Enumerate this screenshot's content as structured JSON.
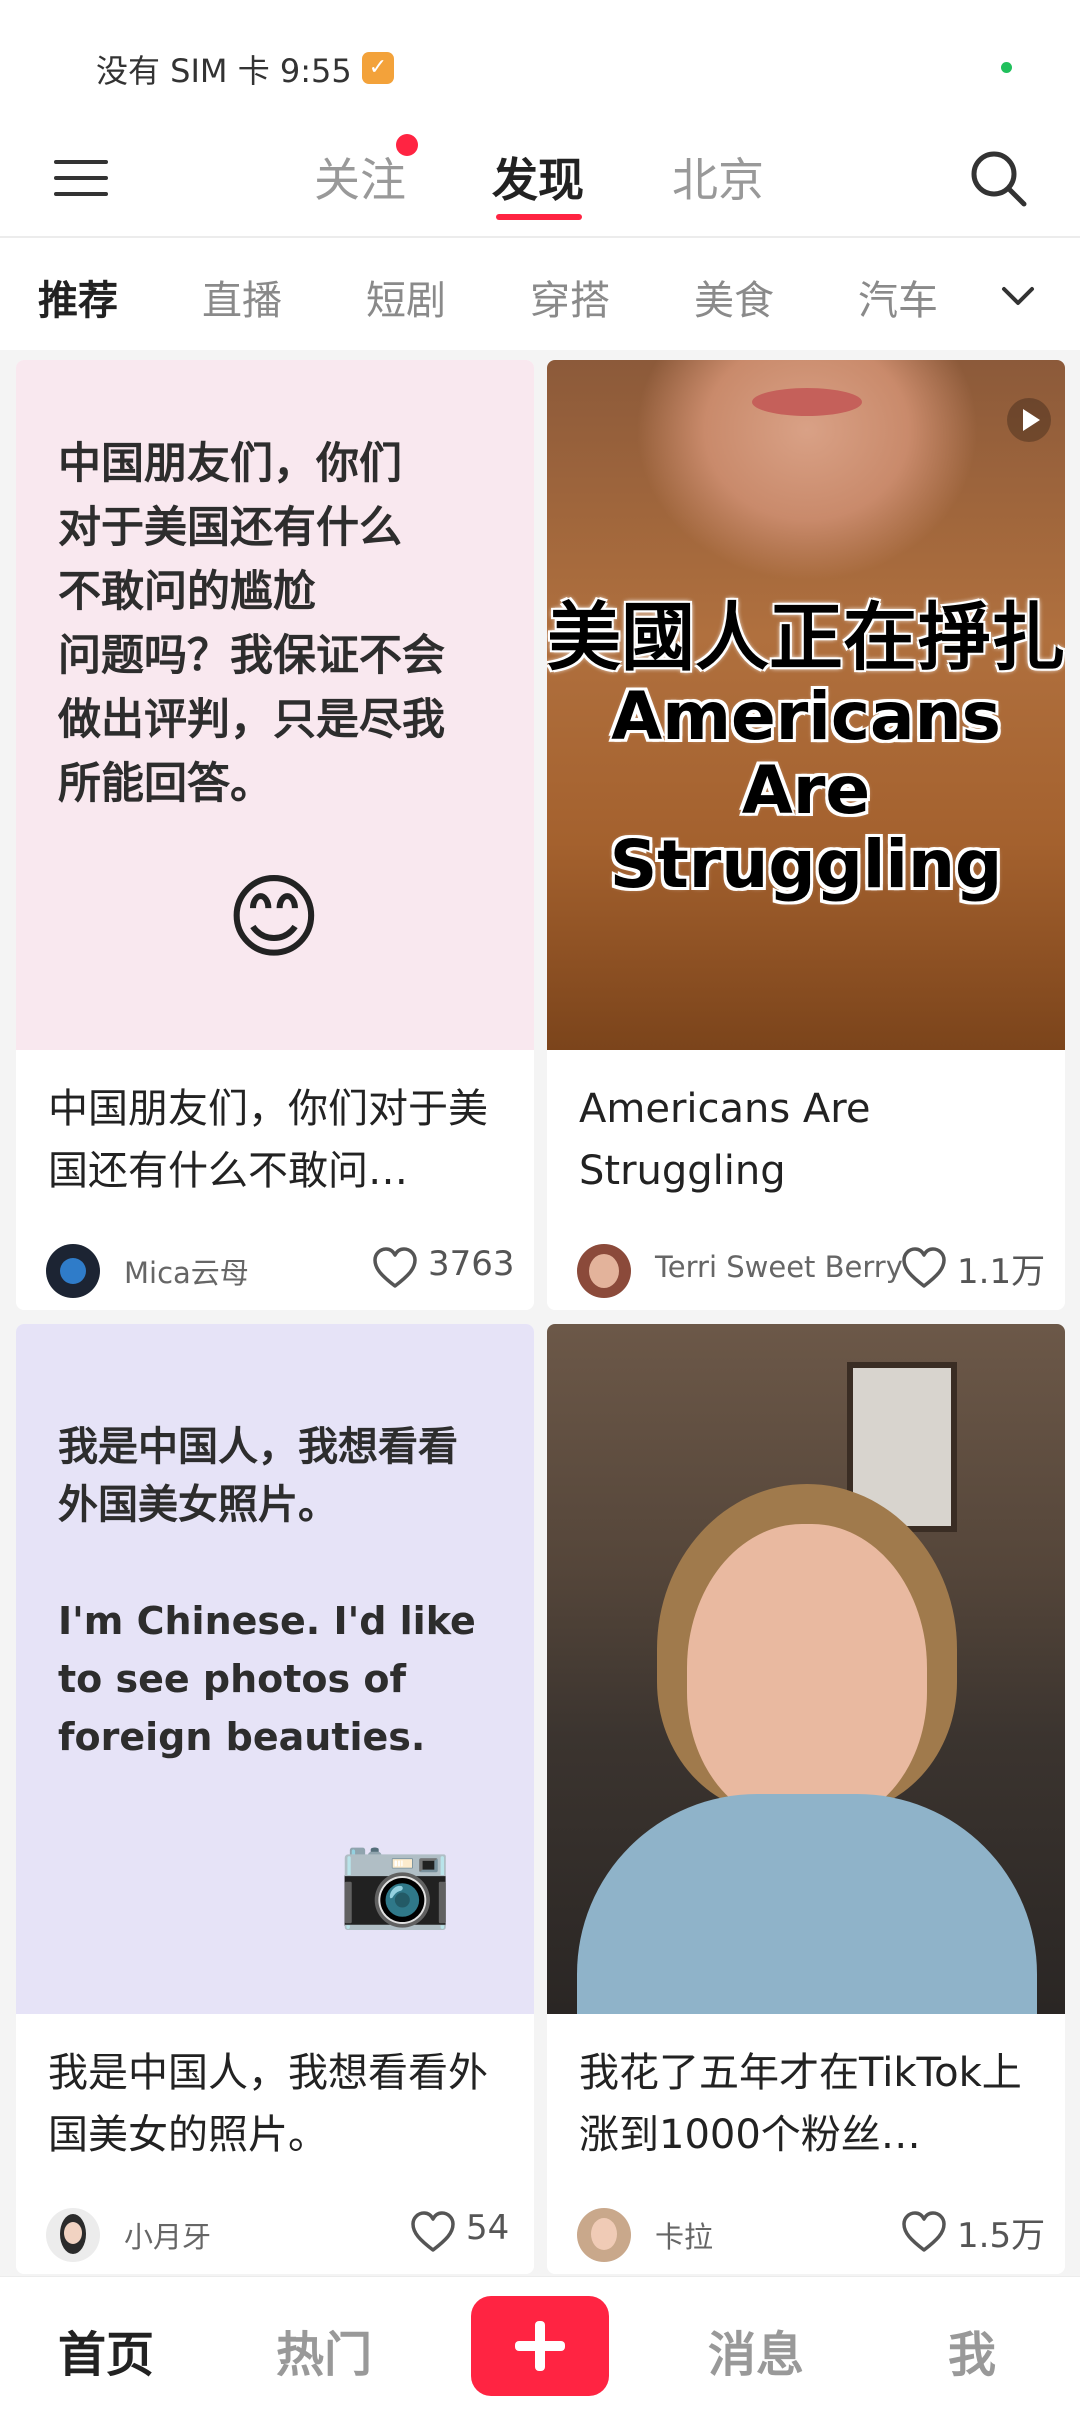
{
  "status_bar": {
    "text": "没有 SIM 卡 9:55",
    "badge_glyph": "✓",
    "indicator_color": "#20c05c"
  },
  "top_nav": {
    "tabs": [
      "关注",
      "发现",
      "北京"
    ],
    "active_tab": "发现",
    "has_notification": true,
    "accent_color": "#ff2442"
  },
  "categories": {
    "items": [
      "推荐",
      "直播",
      "短剧",
      "穿搭",
      "美食",
      "汽车"
    ],
    "active": "推荐"
  },
  "feed": [
    {
      "cover_lines": [
        "中国朋友们，你们",
        "对于美国还有什么",
        "不敢问的尴尬",
        "问题吗？我保证不会",
        "做出评判，只是尽我",
        "所能回答。"
      ],
      "cover_emoji": "😊",
      "title": "中国朋友们，你们对于美国还有什么不敢问…",
      "author": "Mica云母",
      "likes": "3763"
    },
    {
      "cover_cn": "美國人正在掙扎",
      "cover_en_1": "Americans Are",
      "cover_en_2": "Struggling",
      "title": "Americans Are Struggling",
      "author": "Terri Sweet Berry",
      "likes": "1.1万"
    },
    {
      "cover_cn_1": "我是中国人，我想看看",
      "cover_cn_2": "外国美女照片。",
      "cover_en": "I'm Chinese. I'd like to see photos of foreign beauties.",
      "cover_emoji": "📷",
      "title": "我是中国人，我想看看外国美女的照片。",
      "author": "小月牙",
      "likes": "54"
    },
    {
      "title": "我花了五年才在TikTok上涨到1000个粉丝…",
      "author": "卡拉",
      "likes": "1.5万"
    }
  ],
  "bottom_nav": {
    "items": [
      "首页",
      "热门",
      "消息",
      "我"
    ],
    "active": "首页"
  }
}
